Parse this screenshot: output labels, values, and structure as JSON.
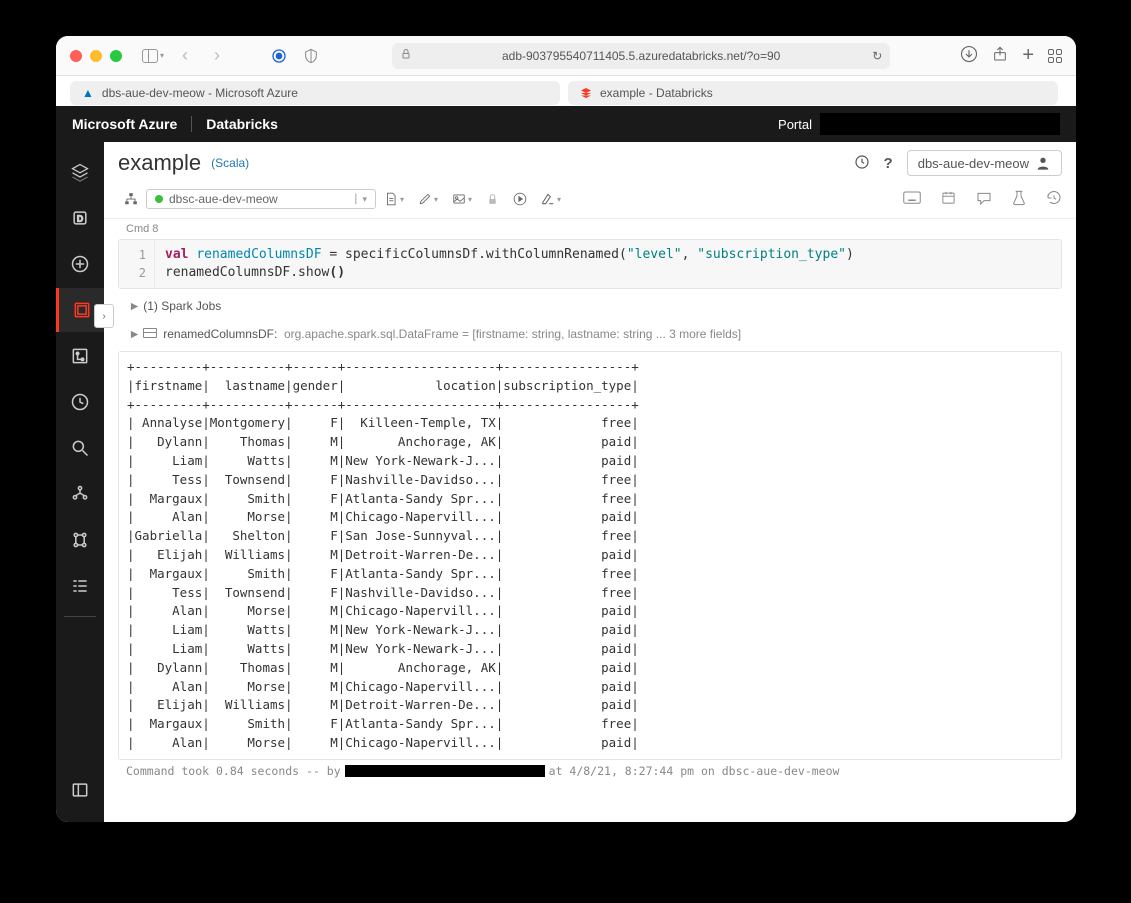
{
  "browser": {
    "url": "adb-903795540711405.5.azuredatabricks.net/?o=90",
    "tabs": [
      {
        "title": "dbs-aue-dev-meow - Microsoft Azure"
      },
      {
        "title": "example - Databricks"
      }
    ]
  },
  "app_header": {
    "brand1": "Microsoft Azure",
    "brand2": "Databricks",
    "portal": "Portal"
  },
  "rail": {
    "items": [
      "databricks",
      "home",
      "create",
      "workspace",
      "repos",
      "recents",
      "search",
      "data",
      "compute",
      "workflows",
      "left-panel"
    ]
  },
  "notebook": {
    "title": "example",
    "language": "(Scala)",
    "cluster": "dbs-aue-dev-meow",
    "attached_cluster": "dbsc-aue-dev-meow",
    "cmd_label": "Cmd 8",
    "spark_jobs": "(1) Spark Jobs",
    "df_info_name": "renamedColumnsDF:",
    "df_info_rest": "org.apache.spark.sql.DataFrame = [firstname: string, lastname: string ... 3 more fields]",
    "footer_prefix": "Command took 0.84 seconds -- by ",
    "footer_suffix": " at 4/8/21, 8:27:44 pm on dbsc-aue-dev-meow"
  },
  "code": {
    "line1": {
      "val": "val",
      "renamed": "renamedColumnsDF",
      "eq": " = ",
      "specific": "specificColumnsDf",
      "wcr": ".withColumnRenamed(",
      "s1": "\"level\"",
      "comma": ", ",
      "s2": "\"subscription_type\"",
      "close": ")"
    },
    "line2": {
      "p1": "renamedColumnsDF.show",
      "p2": "()"
    }
  },
  "columns": [
    "firstname",
    "lastname",
    "gender",
    "location",
    "subscription_type"
  ],
  "rows": [
    [
      "Annalyse",
      "Montgomery",
      "F",
      "Killeen-Temple, TX",
      "free"
    ],
    [
      "Dylann",
      "Thomas",
      "M",
      "Anchorage, AK",
      "paid"
    ],
    [
      "Liam",
      "Watts",
      "M",
      "New York-Newark-J...",
      "paid"
    ],
    [
      "Tess",
      "Townsend",
      "F",
      "Nashville-Davidso...",
      "free"
    ],
    [
      "Margaux",
      "Smith",
      "F",
      "Atlanta-Sandy Spr...",
      "free"
    ],
    [
      "Alan",
      "Morse",
      "M",
      "Chicago-Napervill...",
      "paid"
    ],
    [
      "Gabriella",
      "Shelton",
      "F",
      "San Jose-Sunnyval...",
      "free"
    ],
    [
      "Elijah",
      "Williams",
      "M",
      "Detroit-Warren-De...",
      "paid"
    ],
    [
      "Margaux",
      "Smith",
      "F",
      "Atlanta-Sandy Spr...",
      "free"
    ],
    [
      "Tess",
      "Townsend",
      "F",
      "Nashville-Davidso...",
      "free"
    ],
    [
      "Alan",
      "Morse",
      "M",
      "Chicago-Napervill...",
      "paid"
    ],
    [
      "Liam",
      "Watts",
      "M",
      "New York-Newark-J...",
      "paid"
    ],
    [
      "Liam",
      "Watts",
      "M",
      "New York-Newark-J...",
      "paid"
    ],
    [
      "Dylann",
      "Thomas",
      "M",
      "Anchorage, AK",
      "paid"
    ],
    [
      "Alan",
      "Morse",
      "M",
      "Chicago-Napervill...",
      "paid"
    ],
    [
      "Elijah",
      "Williams",
      "M",
      "Detroit-Warren-De...",
      "paid"
    ],
    [
      "Margaux",
      "Smith",
      "F",
      "Atlanta-Sandy Spr...",
      "free"
    ],
    [
      "Alan",
      "Morse",
      "M",
      "Chicago-Napervill...",
      "paid"
    ]
  ],
  "widths": [
    9,
    10,
    6,
    20,
    17
  ]
}
